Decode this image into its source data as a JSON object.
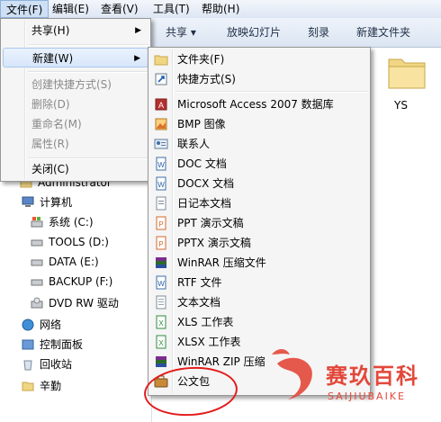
{
  "menubar": {
    "file": "文件(F)",
    "edit": "编辑(E)",
    "view": "查看(V)",
    "tools": "工具(T)",
    "help": "帮助(H)"
  },
  "toolbar": {
    "share": "共享 ▾",
    "slideshow": "放映幻灯片",
    "burn": "刻录",
    "new_folder": "新建文件夹"
  },
  "content": {
    "folder_label": "YS"
  },
  "nav": {
    "items": [
      {
        "label": "Administrator",
        "icon": "user-folder-icon"
      },
      {
        "label": "计算机",
        "icon": "computer-icon"
      },
      {
        "label": "系统 (C:)",
        "icon": "system-drive-icon"
      },
      {
        "label": "TOOLS (D:)",
        "icon": "drive-icon"
      },
      {
        "label": "DATA (E:)",
        "icon": "drive-icon"
      },
      {
        "label": "BACKUP (F:)",
        "icon": "drive-icon"
      },
      {
        "label": "DVD RW 驱动",
        "icon": "dvd-drive-icon"
      },
      {
        "label": "网络",
        "icon": "network-icon"
      },
      {
        "label": "控制面板",
        "icon": "control-panel-icon"
      },
      {
        "label": "回收站",
        "icon": "recycle-bin-icon"
      },
      {
        "label": "辛勤",
        "icon": "folder-icon"
      }
    ]
  },
  "file_menu": {
    "items": [
      {
        "label": "共享(H)",
        "submenu": true,
        "disabled": false
      },
      {
        "label": "新建(W)",
        "submenu": true,
        "disabled": false
      },
      {
        "label": "创建快捷方式(S)",
        "submenu": false,
        "disabled": true
      },
      {
        "label": "删除(D)",
        "submenu": false,
        "disabled": true
      },
      {
        "label": "重命名(M)",
        "submenu": false,
        "disabled": true
      },
      {
        "label": "属性(R)",
        "submenu": false,
        "disabled": true
      },
      {
        "label": "关闭(C)",
        "submenu": false,
        "disabled": false
      }
    ]
  },
  "new_submenu": {
    "items": [
      {
        "label": "文件夹(F)",
        "icon": "folder-icon"
      },
      {
        "label": "快捷方式(S)",
        "icon": "shortcut-icon"
      },
      {
        "label": "Microsoft Access 2007 数据库",
        "icon": "access-icon"
      },
      {
        "label": "BMP 图像",
        "icon": "bmp-icon"
      },
      {
        "label": "联系人",
        "icon": "contact-icon"
      },
      {
        "label": "DOC 文档",
        "icon": "doc-icon"
      },
      {
        "label": "DOCX 文档",
        "icon": "docx-icon"
      },
      {
        "label": "日记本文档",
        "icon": "journal-icon"
      },
      {
        "label": "PPT 演示文稿",
        "icon": "ppt-icon"
      },
      {
        "label": "PPTX 演示文稿",
        "icon": "pptx-icon"
      },
      {
        "label": "WinRAR 压缩文件",
        "icon": "winrar-icon"
      },
      {
        "label": "RTF 文件",
        "icon": "rtf-icon"
      },
      {
        "label": "文本文档",
        "icon": "text-icon"
      },
      {
        "label": "XLS 工作表",
        "icon": "xls-icon"
      },
      {
        "label": "XLSX 工作表",
        "icon": "xlsx-icon"
      },
      {
        "label": "WinRAR ZIP 压缩",
        "icon": "winrar-zip-icon"
      },
      {
        "label": "公文包",
        "icon": "briefcase-icon"
      }
    ]
  },
  "watermark": {
    "title": "赛玖百科",
    "subtitle": "SAIJIUBAIKE"
  }
}
